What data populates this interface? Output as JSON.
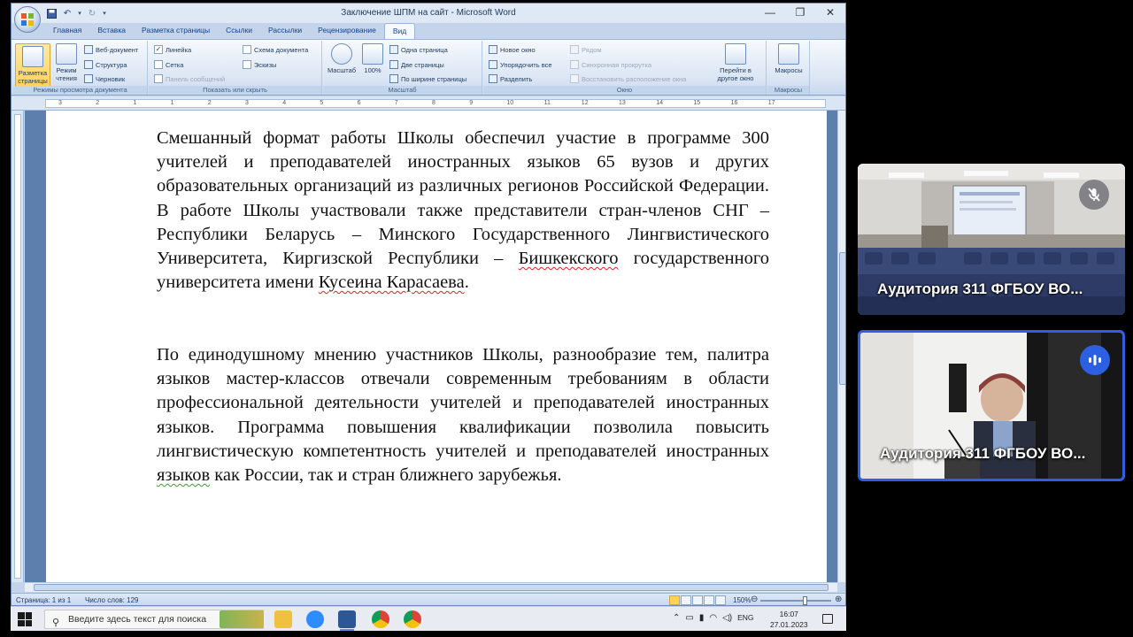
{
  "window": {
    "title": "Заключение ШПМ на сайт - Microsoft Word"
  },
  "ribbon_tabs": [
    "Главная",
    "Вставка",
    "Разметка страницы",
    "Ссылки",
    "Рассылки",
    "Рецензирование",
    "Вид"
  ],
  "active_tab": "Вид",
  "ribbon": {
    "views": {
      "label": "Режимы просмотра документа",
      "page_layout": "Разметка страницы",
      "reading": "Режим чтения",
      "web": "Веб-документ",
      "outline": "Структура",
      "draft": "Черновик"
    },
    "show_hide": {
      "label": "Показать или скрыть",
      "ruler": "Линейка",
      "grid": "Сетка",
      "message_bar": "Панель сообщений",
      "doc_map": "Схема документа",
      "thumbnails": "Эскизы"
    },
    "zoom": {
      "label": "Масштаб",
      "zoom": "Масштаб",
      "percent": "100%",
      "one_page": "Одна страница",
      "two_pages": "Две страницы",
      "page_width": "По ширине страницы"
    },
    "window": {
      "label": "Окно",
      "new_window": "Новое окно",
      "arrange_all": "Упорядочить все",
      "split": "Разделить",
      "side_by_side": "Рядом",
      "sync_scroll": "Синхронная прокрутка",
      "reset_pos": "Восстановить расположение окна",
      "switch_windows": "Перейти в другое окно"
    },
    "macros": {
      "label": "Макросы",
      "macros": "Макросы"
    }
  },
  "ruler_numbers": [
    "3",
    "2",
    "1",
    "1",
    "2",
    "3",
    "4",
    "5",
    "6",
    "7",
    "8",
    "9",
    "10",
    "11",
    "12",
    "13",
    "14",
    "15",
    "16",
    "17"
  ],
  "document": {
    "p1_a": "Смешанный формат работы Школы обеспечил участие в программе 300 учителей и преподавателей иностранных языков 65 вузов и других образовательных организаций из различных регионов Российской Федерации. В работе Школы участвовали также представители стран-членов СНГ – Республики Беларусь – Минского Государственного Лингвистического Университета, Киргизской Республики – ",
    "p1_spell1": "Бишкекского",
    "p1_b": " государственного университета имени ",
    "p1_spell2": "Кусеина Карасаева",
    "p1_c": ".",
    "p2_a": "По единодушному мнению участников Школы, разнообразие тем, палитра языков мастер-классов отвечали современным требованиям в области профессиональной деятельности учителей и преподавателей иностранных языков. Программа повышения квалификации позволила повысить лингвистическую компетентность учителей и преподавателей иностранных ",
    "p2_gram": "языков",
    "p2_b": " как России, так и стран ближнего зарубежья."
  },
  "statusbar": {
    "page": "Страница: 1 из 1",
    "words": "Число слов: 129",
    "zoom": "150%"
  },
  "taskbar": {
    "search_placeholder": "Введите здесь текст для поиска",
    "lang": "ENG",
    "time": "16:07",
    "date": "27.01.2023"
  },
  "video_tiles": [
    {
      "name": "Аудитория 311 ФГБОУ ВО...",
      "muted": true
    },
    {
      "name": "Аудитория 311 ФГБОУ ВО...",
      "speaking": true
    }
  ],
  "colors": {
    "ribbon_bg": "#dbe6f4",
    "doc_bg": "#5d7fad",
    "speaking_border": "#2d5fe3"
  }
}
